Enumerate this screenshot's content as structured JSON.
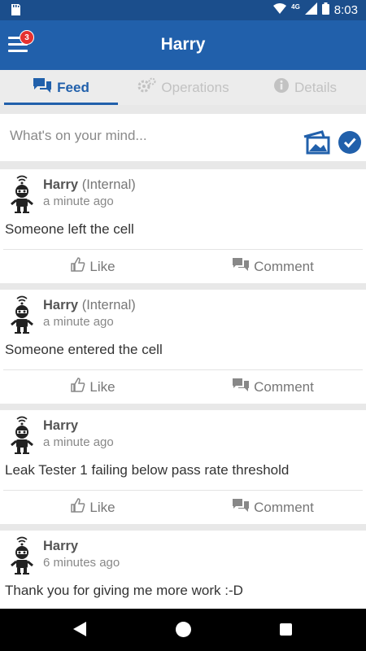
{
  "status_bar": {
    "network": "4G",
    "time": "8:03"
  },
  "app_bar": {
    "title": "Harry",
    "notification_count": "3"
  },
  "tabs": [
    {
      "label": "Feed",
      "icon": "chat-icon",
      "active": true
    },
    {
      "label": "Operations",
      "icon": "gears-icon",
      "active": false
    },
    {
      "label": "Details",
      "icon": "info-icon",
      "active": false
    }
  ],
  "composer": {
    "placeholder": "What's on your mind..."
  },
  "posts": [
    {
      "author": "Harry",
      "role": "(Internal)",
      "time": "a minute ago",
      "body": "Someone left the cell"
    },
    {
      "author": "Harry",
      "role": "(Internal)",
      "time": "a minute ago",
      "body": "Someone entered the cell"
    },
    {
      "author": "Harry",
      "role": "",
      "time": "a minute ago",
      "body": "Leak Tester 1 failing below pass rate threshold"
    },
    {
      "author": "Harry",
      "role": "",
      "time": "6 minutes ago",
      "body": "Thank you for giving me more work :-D"
    }
  ],
  "actions": {
    "like": "Like",
    "comment": "Comment"
  },
  "colors": {
    "primary": "#2160ab",
    "status_bar": "#1b4e8c",
    "badge": "#e5312f"
  }
}
